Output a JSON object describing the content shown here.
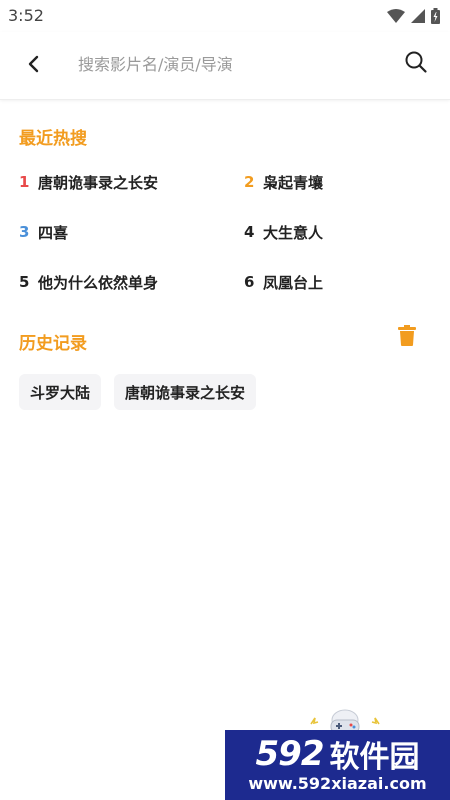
{
  "status_bar": {
    "time": "3:52",
    "icons": [
      "wifi-icon",
      "signal-icon",
      "battery-icon"
    ]
  },
  "search": {
    "placeholder": "搜索影片名/演员/导演",
    "back_icon": "back-arrow-icon",
    "search_icon": "search-icon"
  },
  "hot_search": {
    "title": "最近热搜",
    "items": [
      {
        "rank": "1",
        "text": "唐朝诡事录之长安",
        "color": "#e84a4a"
      },
      {
        "rank": "2",
        "text": "枭起青壤",
        "color": "#f29c1f"
      },
      {
        "rank": "3",
        "text": "四喜",
        "color": "#4a90d9"
      },
      {
        "rank": "4",
        "text": "大生意人",
        "color": "#222222"
      },
      {
        "rank": "5",
        "text": "他为什么依然单身",
        "color": "#222222"
      },
      {
        "rank": "6",
        "text": "凤凰台上",
        "color": "#222222"
      }
    ]
  },
  "history": {
    "title": "历史记录",
    "clear_icon": "trash-icon",
    "items": [
      "斗罗大陆",
      "唐朝诡事录之长安"
    ]
  },
  "watermark": {
    "number": "592",
    "name": "软件园",
    "url": "www.592xiazai.com"
  },
  "colors": {
    "accent": "#f29c1f",
    "watermark_bg": "#1d2a8f"
  }
}
